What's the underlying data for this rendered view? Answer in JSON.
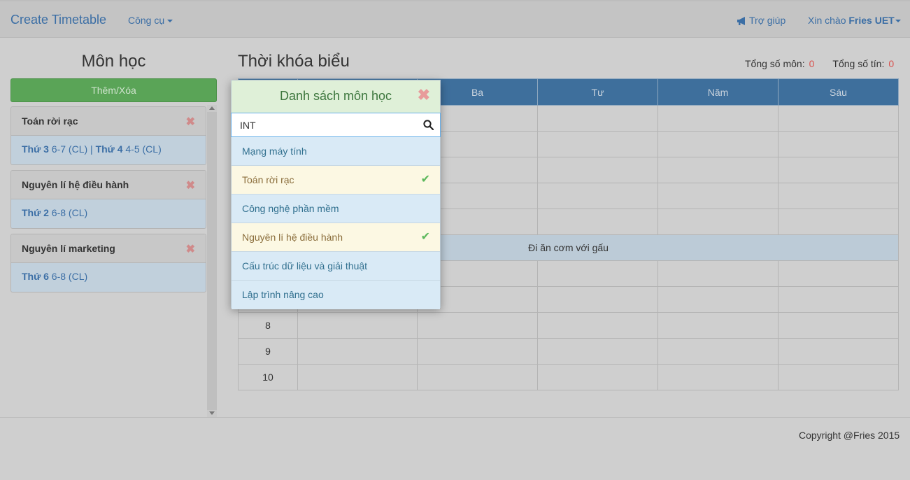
{
  "navbar": {
    "brand": "Create Timetable",
    "tools": "Công cụ",
    "help": "Trợ giúp",
    "greeting_prefix": "Xin chào",
    "user": "Fries UET"
  },
  "left": {
    "title": "Môn học",
    "add_button": "Thêm/Xóa",
    "courses": [
      {
        "name": "Toán rời rạc",
        "d1": "Thứ 3",
        "s1": " 6-7 (CL)",
        "sep": " | ",
        "d2": "Thứ 4",
        "s2": " 4-5 (CL)"
      },
      {
        "name": "Nguyên lí hệ điều hành",
        "d1": "Thứ 2",
        "s1": " 6-8 (CL)"
      },
      {
        "name": "Nguyên lí marketing",
        "d1": "Thứ 6",
        "s1": " 6-8 (CL)"
      }
    ],
    "remove_glyph": "✖"
  },
  "timetable": {
    "title": "Thời khóa biểu",
    "total_courses_label": "Tổng số môn:",
    "total_courses": "0",
    "total_credits_label": "Tổng số tín:",
    "total_credits": "0",
    "headers": [
      "",
      "",
      "Ba",
      "Tư",
      "Năm",
      "Sáu"
    ],
    "note": "Đi ăn cơm với gấu",
    "periods": [
      "",
      "",
      "",
      "",
      "",
      "",
      "",
      "8",
      "9",
      "10"
    ]
  },
  "popup": {
    "title": "Danh sách môn học",
    "close_glyph": "✖",
    "search_value": "INT",
    "items": [
      {
        "label": "Mạng máy tính",
        "selected": false
      },
      {
        "label": "Toán rời rạc",
        "selected": true
      },
      {
        "label": "Công nghệ phần mềm",
        "selected": false
      },
      {
        "label": "Nguyên lí hệ điều hành",
        "selected": true
      },
      {
        "label": "Cấu trúc dữ liệu và giải thuật",
        "selected": false
      },
      {
        "label": "Lập trình nâng cao",
        "selected": false
      }
    ],
    "check_glyph": "✔"
  },
  "footer": {
    "copyright": "Copyright @Fries 2015"
  },
  "colors": {
    "accent": "#3b6ea5",
    "success": "#5aa457",
    "table_header": "#3e6f9c",
    "danger": "#d9534f"
  }
}
